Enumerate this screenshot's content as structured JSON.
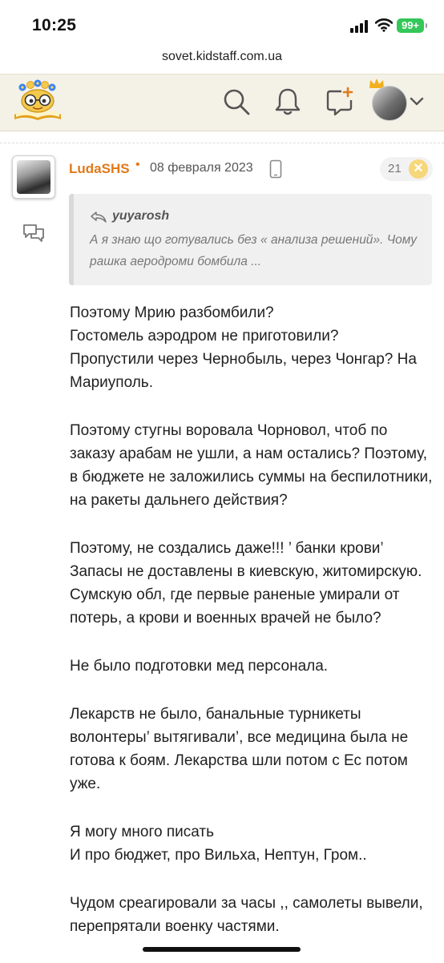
{
  "status_bar": {
    "time": "10:25",
    "battery": "99+"
  },
  "browser": {
    "url": "sovet.kidstaff.com.ua"
  },
  "header": {
    "icons": [
      "search-icon",
      "bell-icon",
      "new-post-icon",
      "avatar",
      "chevron-down-icon"
    ]
  },
  "post": {
    "author": "LudaSHS",
    "separator": "•",
    "date": "08 февраля 2023",
    "rating": "21",
    "rating_close": "✕",
    "quote": {
      "author": "yuyarosh",
      "text": "А я знаю що готувались без « анализа решений». Чому рашка аеродроми бомбила ..."
    },
    "paragraphs": [
      [
        "Поэтому Мрию разбомбили?",
        "Гостомель аэродром не приготовили?",
        "Пропустили через Чернобыль, через Чонгар? На Мариуполь."
      ],
      [
        "Поэтому стугны воровала Чорновол, чтоб по заказу арабам не ушли, а нам остались? Поэтому, в бюджете не заложились суммы на беспилотники, на ракеты дальнего действия?"
      ],
      [
        "Поэтому, не создались даже!!! ’ банки крови’ Запасы не доставлены в киевскую, житомирскую. Сумскую обл, где первые раненые умирали от потерь, а крови и военных врачей не было?"
      ],
      [
        "Не было подготовки мед персонала."
      ],
      [
        "Лекарств не было, банальные турникеты волонтеры’ вытягивали’, все медицина была не готова к боям. Лекарства шли потом с Ес потом уже."
      ],
      [
        "Я могу много писать",
        "И про бюджет, про Вильха, Нептун, Гром.."
      ],
      [
        "Чудом среагировали за часы ,, самолеты вывели, перепрятали военку частями."
      ]
    ]
  },
  "colors": {
    "accent": "#e07a1a",
    "header_bg": "#f4f1e7",
    "quote_bg": "#f0f0f0",
    "battery": "#34c759"
  }
}
